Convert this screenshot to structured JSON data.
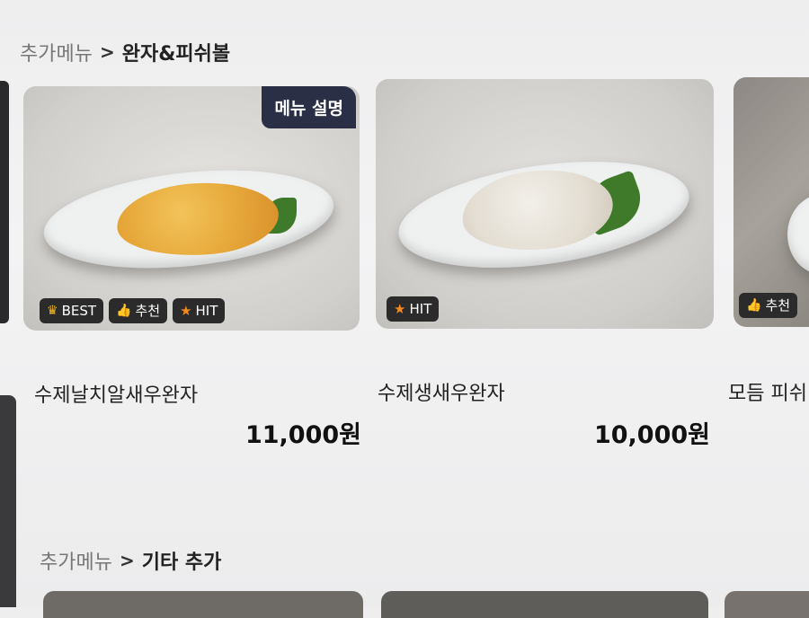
{
  "section1": {
    "parent": "추가메뉴",
    "separator": ">",
    "current": "완자&피쉬볼"
  },
  "section2": {
    "parent": "추가메뉴",
    "separator": ">",
    "current": "기타 추가"
  },
  "menu_description_button": "메뉴 설명",
  "items": [
    {
      "name": "수제날치알새우완자",
      "price": "11,000원",
      "badges": [
        {
          "icon": "crown-icon",
          "label": "BEST"
        },
        {
          "icon": "thumbs-up-icon",
          "label": "추천"
        },
        {
          "icon": "star-icon",
          "label": "HIT"
        }
      ]
    },
    {
      "name": "수제생새우완자",
      "price": "10,000원",
      "badges": [
        {
          "icon": "star-icon",
          "label": "HIT"
        }
      ]
    },
    {
      "name": "모듬 피쉬",
      "badges": [
        {
          "icon": "thumbs-up-icon",
          "label": "추천"
        }
      ]
    }
  ],
  "colors": {
    "badge_bg": "#2b2b2b",
    "button_bg": "#2b2f45",
    "crown": "#f0b52a",
    "thumb": "#5aa7e8",
    "star": "#f28a22"
  }
}
